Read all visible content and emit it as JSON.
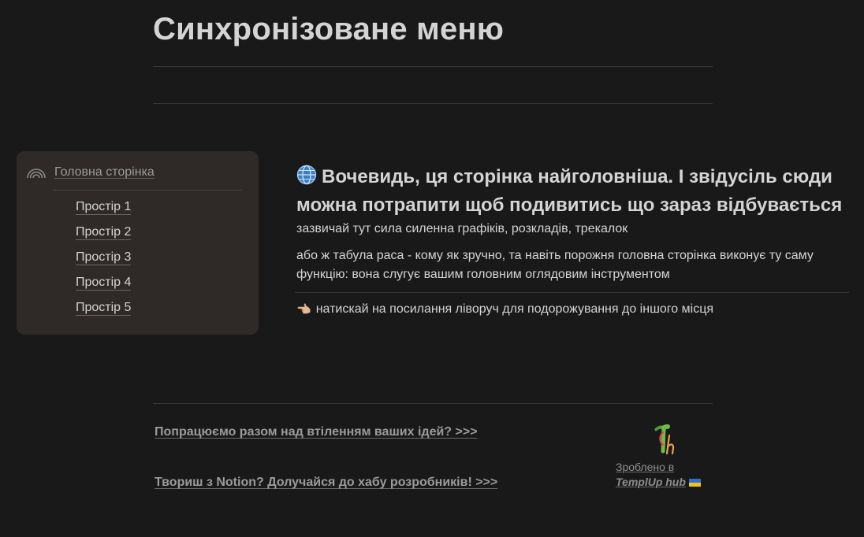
{
  "page": {
    "title": "Синхронізоване меню"
  },
  "sidebar": {
    "home_link": "Головна сторінка",
    "items": [
      {
        "label": "Простір 1"
      },
      {
        "label": "Простір 2"
      },
      {
        "label": "Простір 3"
      },
      {
        "label": "Простір 4"
      },
      {
        "label": "Простір 5"
      }
    ]
  },
  "main": {
    "heading": "Вочевидь, ця сторінка найголовніша. І звідусіль сюди можна потрапити щоб подивитись що зараз відбувається",
    "paragraph_1": "зазвичай тут сила силенна графіків, розкладів, трекалок",
    "paragraph_2": "або ж табула раса - кому як зручно, та навіть порожня головна сторінка виконує ту саму функцію: вона слугує вашим головним оглядовим інструментом",
    "hint": "натискай на посилання ліворуч для подорожування до іншого місця",
    "hint_icon": "pointing-left-hand-icon"
  },
  "footer": {
    "link_1": "Попрацюємо разом над втіленням ваших ідей? >>>",
    "link_2": "Твориш з Notion? Долучайся до хабу розробників! >>>",
    "made_by_prefix": "Зроблено в",
    "made_by_brand": "TemplUp hub"
  },
  "colors": {
    "background": "#191919",
    "card": "#2f2a27",
    "text": "#d4d4d4",
    "muted": "#9b9b9b"
  }
}
